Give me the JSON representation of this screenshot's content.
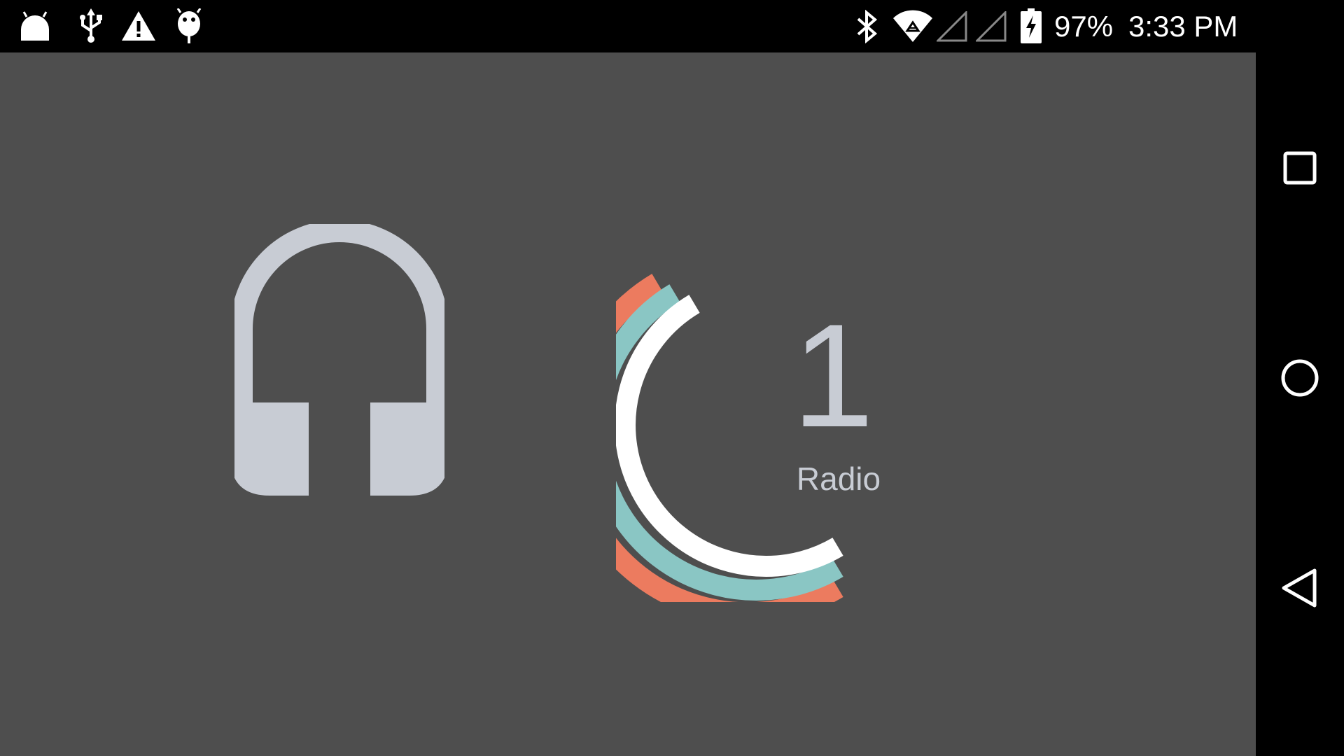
{
  "status_bar": {
    "left_icons": [
      "android-notification-icon",
      "usb-icon",
      "warning-icon",
      "debug-bug-icon"
    ],
    "right_icons": [
      "bluetooth-icon",
      "wifi-icon",
      "signal-empty-icon",
      "signal-empty-icon",
      "battery-charging-icon"
    ],
    "battery_text": "97%",
    "time": "3:33 PM"
  },
  "main": {
    "media_icon": "headphones-icon",
    "radio": {
      "number": "1",
      "label": "Radio",
      "arc_colors": [
        "#ec7b5f",
        "#8ac6c4",
        "#ffffff"
      ]
    }
  },
  "nav_bar": {
    "buttons": [
      "recents-button",
      "home-button",
      "back-button"
    ]
  },
  "colors": {
    "background": "#4e4e4e",
    "icon": "#c8ccd4",
    "bars": "#000000"
  }
}
